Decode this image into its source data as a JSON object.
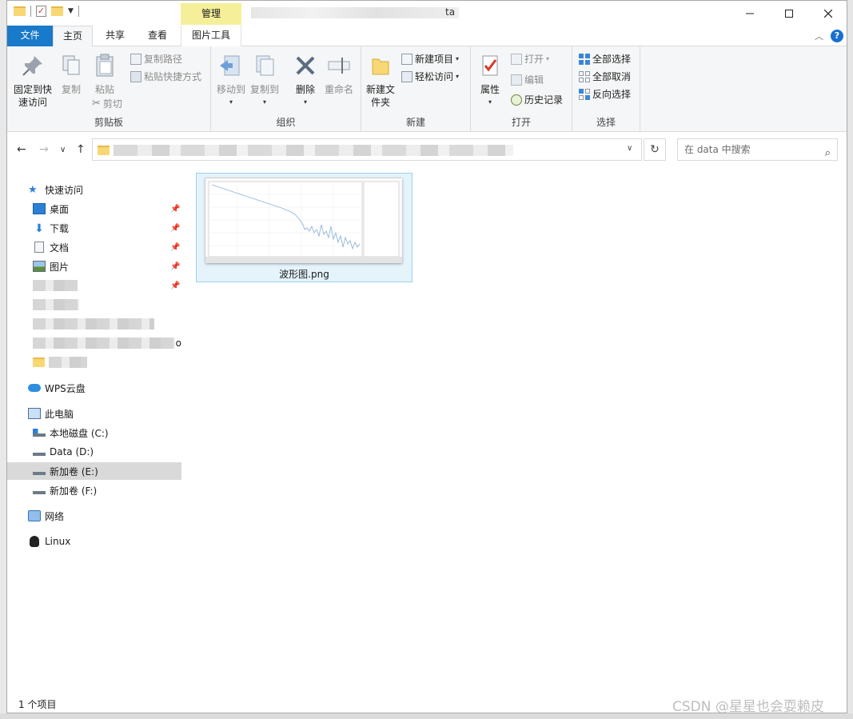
{
  "window": {
    "title_suffix": "ta",
    "context_group": "管理"
  },
  "tabs": {
    "file": "文件",
    "home": "主页",
    "share": "共享",
    "view": "查看",
    "picture_tools": "图片工具"
  },
  "ribbon": {
    "clipboard": {
      "label": "剪贴板",
      "pin_quick_access": "固定到快速访问",
      "copy": "复制",
      "paste": "粘贴",
      "copy_path": "复制路径",
      "paste_shortcut": "粘贴快捷方式",
      "cut": "剪切"
    },
    "organize": {
      "label": "组织",
      "move_to": "移动到",
      "copy_to": "复制到",
      "delete": "删除",
      "rename": "重命名"
    },
    "new": {
      "label": "新建",
      "new_folder": "新建文件夹",
      "new_item": "新建项目",
      "easy_access": "轻松访问"
    },
    "open": {
      "label": "打开",
      "properties": "属性",
      "open": "打开",
      "edit": "编辑",
      "history": "历史记录"
    },
    "select": {
      "label": "选择",
      "select_all": "全部选择",
      "select_none": "全部取消",
      "invert": "反向选择"
    }
  },
  "address": {
    "search_placeholder": "在 data 中搜索"
  },
  "nav": {
    "quick_access": "快速访问",
    "desktop": "桌面",
    "downloads": "下载",
    "documents": "文档",
    "pictures": "图片",
    "wps": "WPS云盘",
    "this_pc": "此电脑",
    "drive_c": "本地磁盘 (C:)",
    "drive_d": "Data (D:)",
    "drive_e": "新加卷 (E:)",
    "drive_f": "新加卷 (F:)",
    "network": "网络",
    "linux": "Linux",
    "blur_suffix": "o"
  },
  "files": [
    {
      "name": "波形图.png"
    }
  ],
  "status": {
    "count": "1 个项目",
    "watermark": "CSDN @星星也会耍赖皮"
  },
  "colors": {
    "accent": "#1979ca",
    "context_tab": "#f5ef9a",
    "selection_bg": "#e5f3fb",
    "selection_border": "#99d1f2"
  }
}
